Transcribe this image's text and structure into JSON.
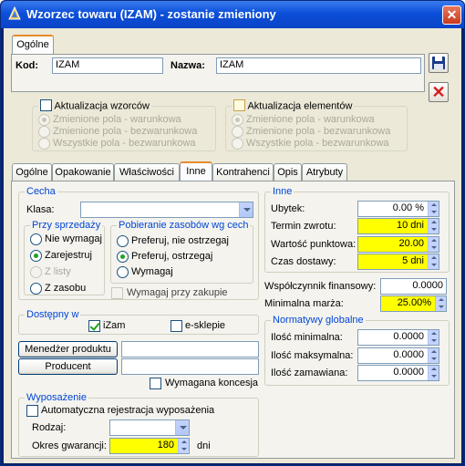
{
  "window": {
    "title": "Wzorzec towaru (IZAM) - zostanie zmieniony",
    "close": "✕"
  },
  "top": {
    "tab": "Ogólne",
    "kod_label": "Kod:",
    "kod_value": "IZAM",
    "nazwa_label": "Nazwa:",
    "nazwa_value": "IZAM",
    "save_icon": "floppy-disk-icon",
    "cancel_icon": "red-x-icon",
    "cancel_glyph": "✕"
  },
  "aktualizacja_wzorcow": {
    "label": "Aktualizacja wzorców",
    "options": [
      "Zmienione pola - warunkowa",
      "Zmienione pola - bezwarunkowa",
      "Wszystkie pola - bezwarunkowa"
    ]
  },
  "aktualizacja_elementow": {
    "label": "Aktualizacja elementów",
    "options": [
      "Zmienione pola - warunkowa",
      "Zmienione pola - bezwarunkowa",
      "Wszystkie pola - bezwarunkowa"
    ]
  },
  "tabs": [
    "Ogólne",
    "Opakowanie",
    "Właściwości",
    "Inne",
    "Kontrahenci",
    "Opis",
    "Atrybuty"
  ],
  "active_tab": "Inne",
  "cecha": {
    "title": "Cecha",
    "klasa_label": "Klasa:",
    "klasa_value": "",
    "przy_sprzedazy": {
      "title": "Przy sprzedaży",
      "options": [
        "Nie wymagaj",
        "Zarejestruj",
        "Z listy",
        "Z zasobu"
      ],
      "selected": "Zarejestruj"
    },
    "pobieranie": {
      "title": "Pobieranie zasobów wg cech",
      "options": [
        "Preferuj, nie ostrzegaj",
        "Preferuj, ostrzegaj",
        "Wymagaj"
      ],
      "selected": "Preferuj, ostrzegaj"
    },
    "wymagaj_przy_zakupie": "Wymagaj przy zakupie"
  },
  "dostepny_w": {
    "title": "Dostępny w",
    "izam": "iZam",
    "esklepie": "e-sklepie"
  },
  "menedzer_label": "Menedżer produktu",
  "menedzer_value": "",
  "producent_label": "Producent",
  "producent_value": "",
  "wymagana_koncesja": "Wymagana koncesja",
  "wyposazenie": {
    "title": "Wyposażenie",
    "auto": "Automatyczna rejestracja wyposażenia",
    "rodzaj_label": "Rodzaj:",
    "rodzaj_value": "",
    "okres_label": "Okres gwarancji:",
    "okres_value": "180",
    "okres_unit": "dni"
  },
  "inne": {
    "title": "Inne",
    "ubytek_label": "Ubytek:",
    "ubytek_value": "0.00 %",
    "termin_label": "Termin zwrotu:",
    "termin_value": "10 dni",
    "wartosc_label": "Wartość punktowa:",
    "wartosc_value": "20.00",
    "czas_label": "Czas dostawy:",
    "czas_value": "5 dni"
  },
  "wspolczynnik_label": "Współczynnik finansowy:",
  "wspolczynnik_value": "0.0000",
  "marza_label": "Minimalna marża:",
  "marza_value": "25.00%",
  "normatywy": {
    "title": "Normatywy globalne",
    "min_label": "Ilość minimalna:",
    "min_value": "0.0000",
    "max_label": "Ilość maksymalna:",
    "max_value": "0.0000",
    "zam_label": "Ilość zamawiana:",
    "zam_value": "0.0000"
  }
}
